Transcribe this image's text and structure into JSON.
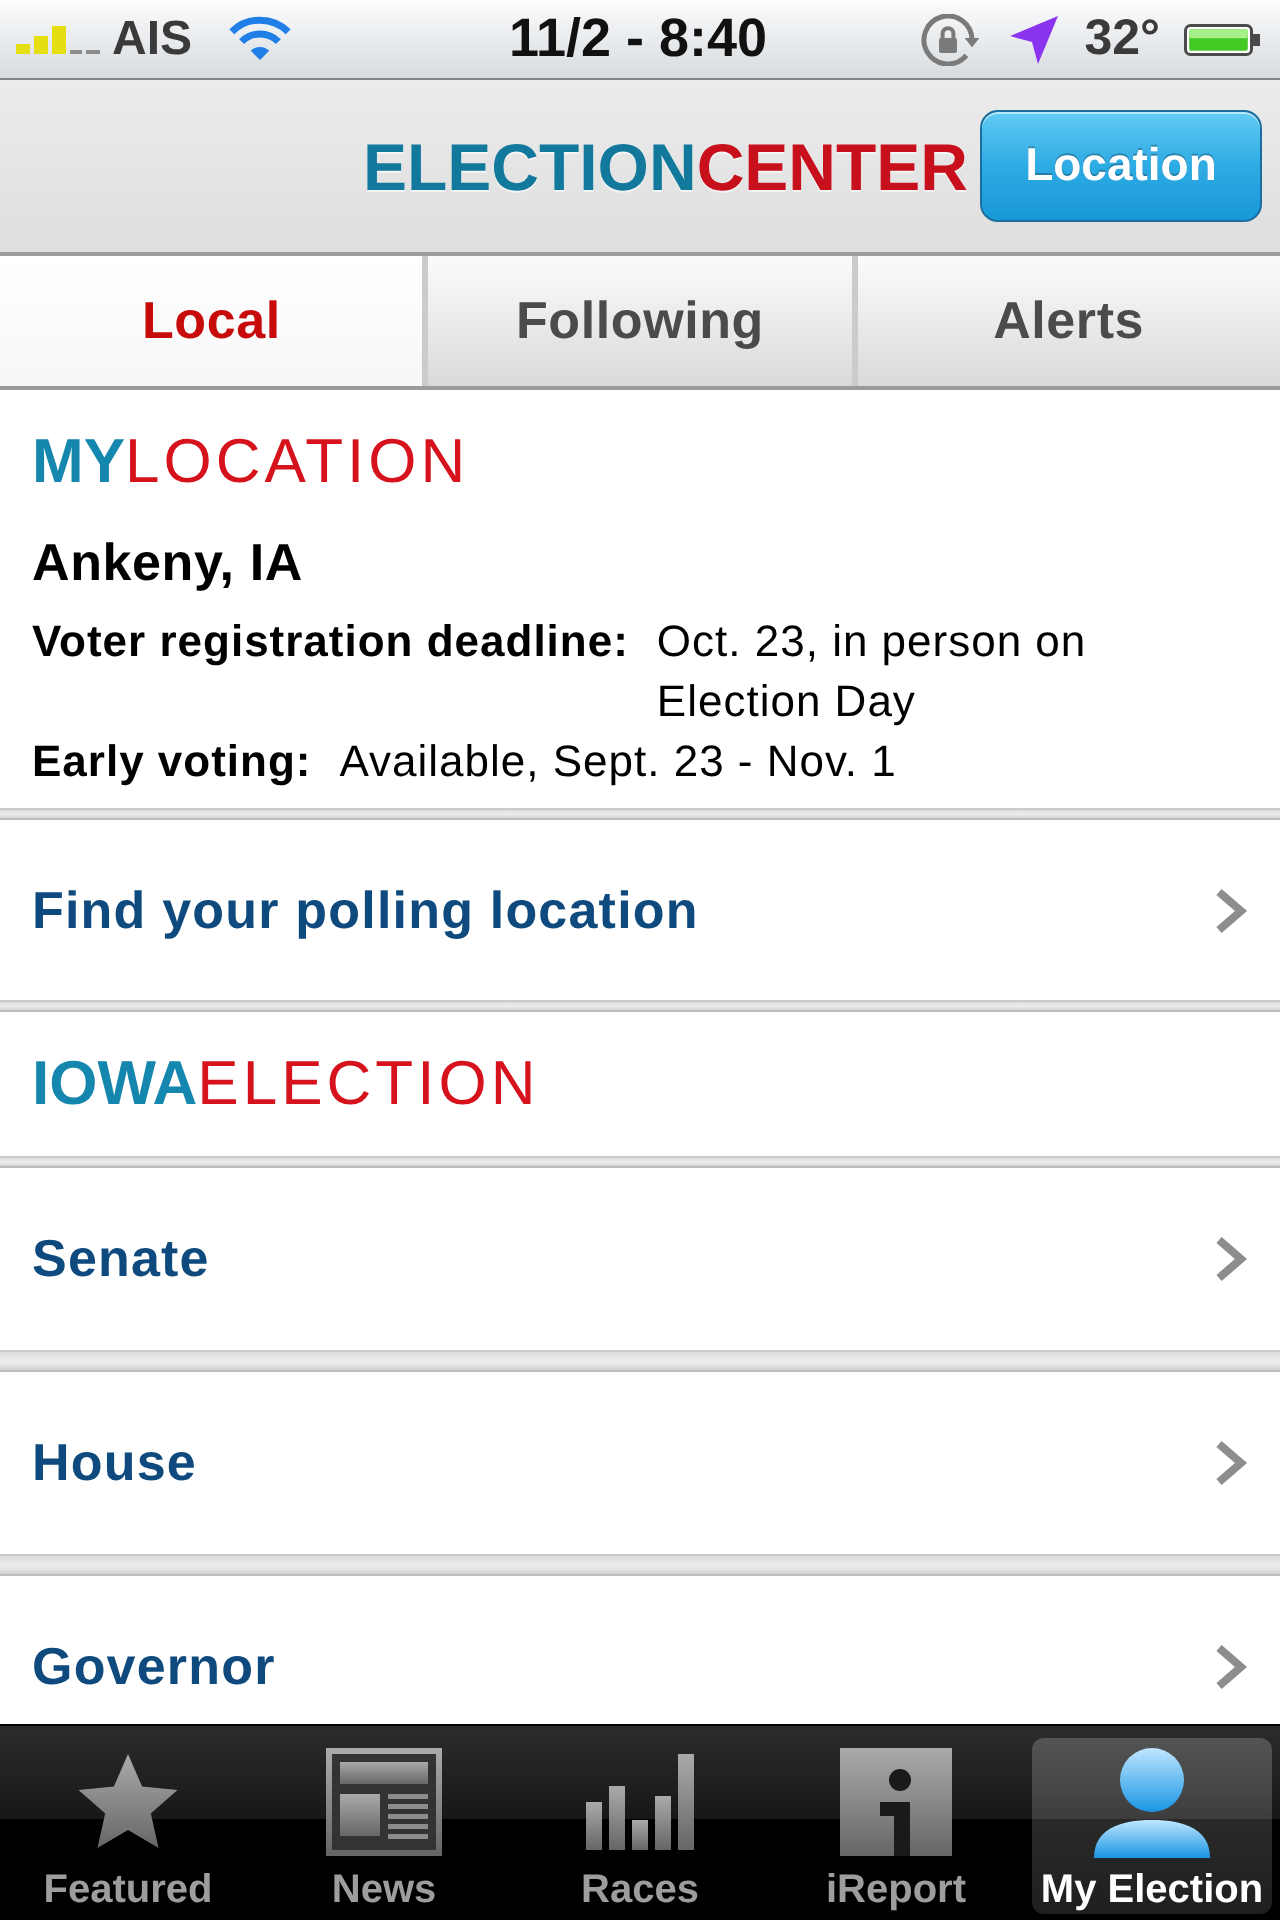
{
  "status_bar": {
    "carrier": "AIS",
    "time": "11/2 - 8:40",
    "temperature": "32°"
  },
  "header": {
    "logo_lead": "ELECTION",
    "logo_rest": "CENTER",
    "button": "Location"
  },
  "tabs": [
    {
      "label": "Local",
      "selected": true
    },
    {
      "label": "Following",
      "selected": false
    },
    {
      "label": "Alerts",
      "selected": false
    }
  ],
  "my_location": {
    "heading_lead": "MY",
    "heading_rest": "LOCATION",
    "city": "Ankeny, IA",
    "details": [
      {
        "label": "Voter registration deadline:",
        "value": "Oct. 23, in person on Election Day"
      },
      {
        "label": "Early voting:",
        "value": "Available, Sept. 23 - Nov. 1"
      }
    ],
    "link": "Find your polling location"
  },
  "state_election": {
    "heading_lead": "IOWA",
    "heading_rest": "ELECTION",
    "races": [
      "Senate",
      "House",
      "Governor"
    ]
  },
  "tab_bar": [
    {
      "label": "Featured",
      "selected": false
    },
    {
      "label": "News",
      "selected": false
    },
    {
      "label": "Races",
      "selected": false
    },
    {
      "label": "iReport",
      "selected": false
    },
    {
      "label": "My Election",
      "selected": true
    }
  ]
}
